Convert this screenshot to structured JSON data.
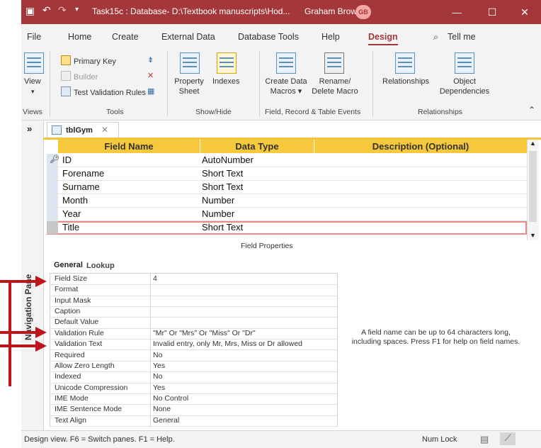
{
  "window": {
    "title": "Task15c : Database- D:\\Textbook manuscripts\\Hod...",
    "user": "Graham Brown",
    "user_initials": "GB"
  },
  "menu": [
    "File",
    "Home",
    "Create",
    "External Data",
    "Database Tools",
    "Help",
    "Design"
  ],
  "tell_me": "Tell me",
  "ribbon": {
    "view": "View",
    "primary_key": "Primary Key",
    "builder": "Builder",
    "test_validation_rules": "Test Validation Rules",
    "property_sheet_1": "Property",
    "property_sheet_2": "Sheet",
    "indexes": "Indexes",
    "create_data_1": "Create Data",
    "create_data_2": "Macros ▾",
    "rename_1": "Rename/",
    "rename_2": "Delete Macro",
    "relationships": "Relationships",
    "object_dep_1": "Object",
    "object_dep_2": "Dependencies",
    "groups": {
      "views": "Views",
      "tools": "Tools",
      "show_hide": "Show/Hide",
      "events": "Field, Record & Table Events",
      "relationships": "Relationships"
    }
  },
  "nav_pane": "Navigation Pane",
  "tab": "tblGym",
  "grid": {
    "headers": [
      "Field Name",
      "Data Type",
      "Description (Optional)"
    ],
    "rows": [
      {
        "name": "ID",
        "type": "AutoNumber"
      },
      {
        "name": "Forename",
        "type": "Short Text"
      },
      {
        "name": "Surname",
        "type": "Short Text"
      },
      {
        "name": "Month",
        "type": "Number"
      },
      {
        "name": "Year",
        "type": "Number"
      },
      {
        "name": "Title",
        "type": "Short Text"
      }
    ]
  },
  "field_properties": {
    "title": "Field Properties",
    "tabs": [
      "General",
      "Lookup"
    ],
    "rows": [
      {
        "name": "Field Size",
        "value": "4"
      },
      {
        "name": "Format",
        "value": ""
      },
      {
        "name": "Input Mask",
        "value": ""
      },
      {
        "name": "Caption",
        "value": ""
      },
      {
        "name": "Default Value",
        "value": ""
      },
      {
        "name": "Validation Rule",
        "value": "\"Mr\" Or \"Mrs\" Or \"Miss\" Or \"Dr\""
      },
      {
        "name": "Validation Text",
        "value": "Invalid entry, only Mr, Mrs, Miss or Dr allowed"
      },
      {
        "name": "Required",
        "value": "No"
      },
      {
        "name": "Allow Zero Length",
        "value": "Yes"
      },
      {
        "name": "Indexed",
        "value": "No"
      },
      {
        "name": "Unicode Compression",
        "value": "Yes"
      },
      {
        "name": "IME Mode",
        "value": "No Control"
      },
      {
        "name": "IME Sentence Mode",
        "value": "None"
      },
      {
        "name": "Text Align",
        "value": "General"
      }
    ],
    "help": "A field name can be up to 64 characters long, including spaces. Press F1 for help on field names."
  },
  "status": {
    "left": "Design view.  F6 = Switch panes.  F1 = Help.",
    "num_lock": "Num Lock"
  },
  "colors": {
    "title_bar": "#a4373a",
    "grid_header": "#f6c83c",
    "annotation_arrow": "#c0141a"
  }
}
